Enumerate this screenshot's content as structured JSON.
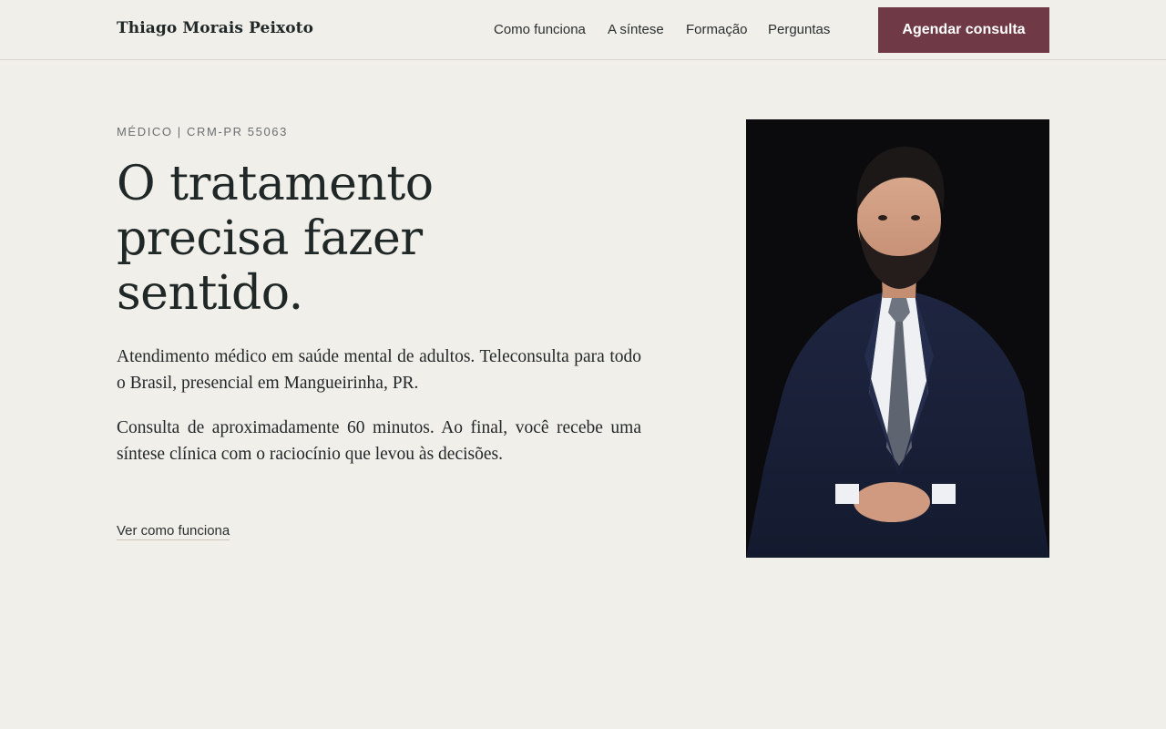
{
  "header": {
    "brand": "Thiago Morais Peixoto",
    "nav": [
      "Como funciona",
      "A síntese",
      "Formação",
      "Perguntas"
    ],
    "cta_label": "Agendar consulta"
  },
  "hero": {
    "eyebrow": "MÉDICO | CRM-PR 55063",
    "headline": "O tratamento precisa fazer sentido.",
    "paragraphs": [
      "Atendimento médico em saúde mental de adultos. Teleconsulta para todo o Brasil, presencial em Mangueirinha, PR.",
      "Consulta de aproximadamente 60 minutos. Ao final, você recebe uma síntese clínica com o raciocínio que levou às decisões."
    ],
    "link_label": "Ver como funciona"
  },
  "colors": {
    "background": "#f1efea",
    "accent": "#6f3a45",
    "text": "#1f2727"
  }
}
